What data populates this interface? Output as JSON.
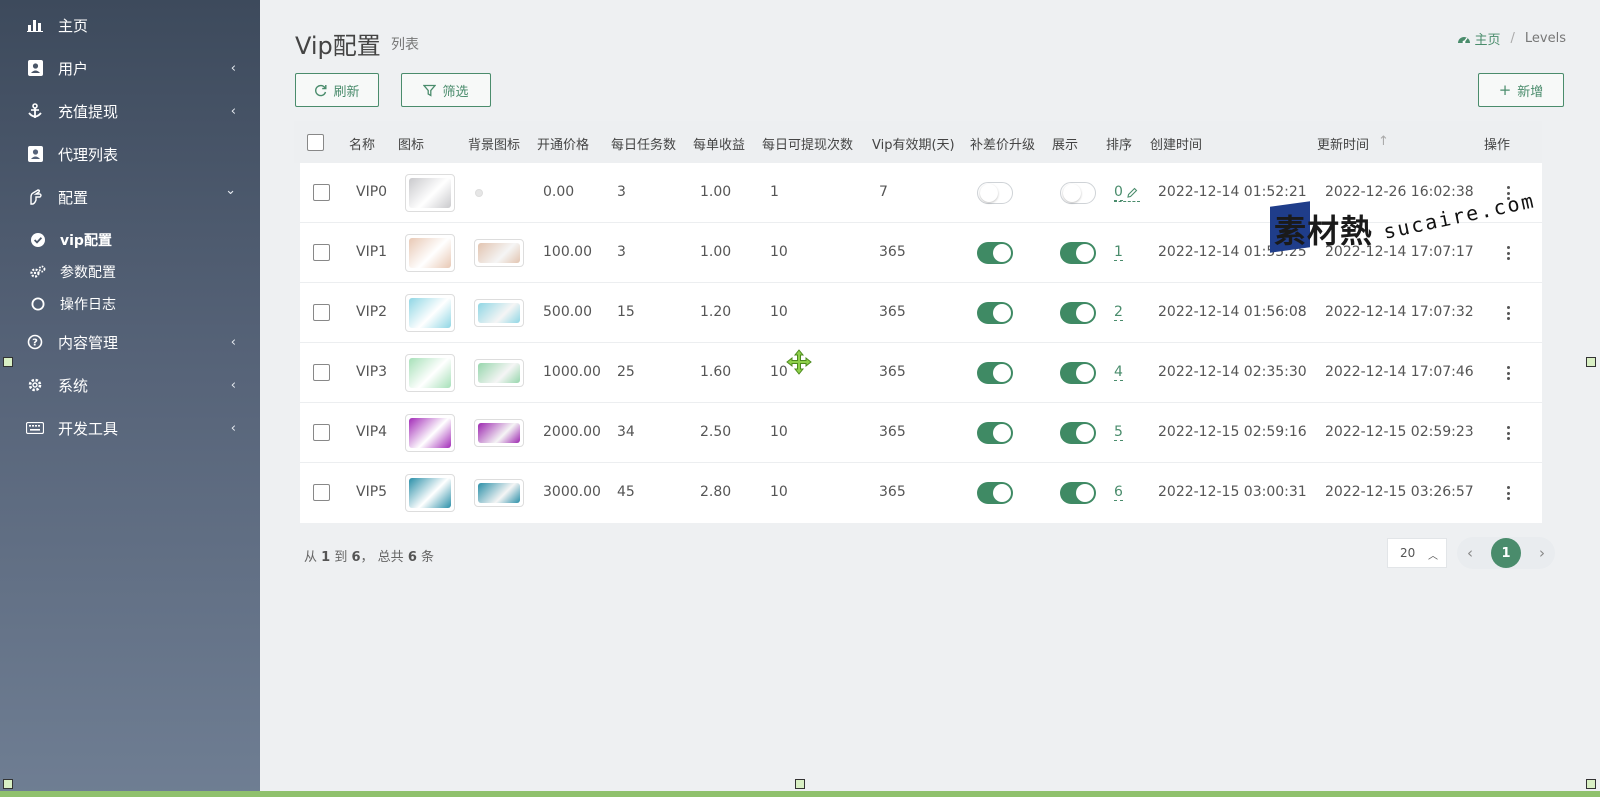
{
  "sidebar": {
    "items": [
      {
        "label": "主页",
        "icon": "bar-chart-icon",
        "chevron": ""
      },
      {
        "label": "用户",
        "icon": "id-card-icon",
        "chevron": "‹"
      },
      {
        "label": "充值提现",
        "icon": "anchor-icon",
        "chevron": "‹"
      },
      {
        "label": "代理列表",
        "icon": "address-book-icon",
        "chevron": ""
      },
      {
        "label": "配置",
        "icon": "hand-icon",
        "chevron": "⌄"
      },
      {
        "label": "内容管理",
        "icon": "question-circle-icon",
        "chevron": "‹"
      },
      {
        "label": "系统",
        "icon": "gear-icon",
        "chevron": "‹"
      },
      {
        "label": "开发工具",
        "icon": "keyboard-icon",
        "chevron": "‹"
      }
    ],
    "subitems": [
      {
        "label": "vip配置",
        "icon": "check-circle-icon",
        "active": true
      },
      {
        "label": "参数配置",
        "icon": "cogs-icon",
        "active": false
      },
      {
        "label": "操作日志",
        "icon": "circle-outline-icon",
        "active": false
      }
    ]
  },
  "header": {
    "title": "Vip配置",
    "subtitle": "列表",
    "breadcrumb": {
      "home": "主页",
      "separator": "/",
      "current": "Levels"
    }
  },
  "toolbar": {
    "refresh_label": "刷新",
    "filter_label": "筛选",
    "add_label": "新增"
  },
  "table": {
    "columns": [
      "名称",
      "图标",
      "背景图标",
      "开通价格",
      "每日任务数",
      "每单收益",
      "每日可提现次数",
      "Vip有效期(天)",
      "补差价升级",
      "展示",
      "排序",
      "创建时间",
      "更新时间",
      "操作"
    ],
    "sort_indicator": "↑",
    "rows": [
      {
        "name": "VIP0",
        "icon_color": "#c9c9cc",
        "bg_color": "",
        "price": "0.00",
        "tasks": "3",
        "profit": "1.00",
        "withdraw": "1",
        "days": "7",
        "upgrade": false,
        "show": false,
        "sort": "0",
        "created": "2022-12-14 01:52:21",
        "updated": "2022-12-26 16:02:38"
      },
      {
        "name": "VIP1",
        "icon_color": "#e8c8b4",
        "bg_color": "#e2c4b0",
        "price": "100.00",
        "tasks": "3",
        "profit": "1.00",
        "withdraw": "10",
        "days": "365",
        "upgrade": true,
        "show": true,
        "sort": "1",
        "created": "2022-12-14 01:55:25",
        "updated": "2022-12-14 17:07:17"
      },
      {
        "name": "VIP2",
        "icon_color": "#8fd6e4",
        "bg_color": "#8fd6e4",
        "price": "500.00",
        "tasks": "15",
        "profit": "1.20",
        "withdraw": "10",
        "days": "365",
        "upgrade": true,
        "show": true,
        "sort": "2",
        "created": "2022-12-14 01:56:08",
        "updated": "2022-12-14 17:07:32"
      },
      {
        "name": "VIP3",
        "icon_color": "#a6e0b8",
        "bg_color": "#96d6ac",
        "price": "1000.00",
        "tasks": "25",
        "profit": "1.60",
        "withdraw": "10",
        "days": "365",
        "upgrade": true,
        "show": true,
        "sort": "4",
        "created": "2022-12-14 02:35:30",
        "updated": "2022-12-14 17:07:46"
      },
      {
        "name": "VIP4",
        "icon_color": "#a22bb8",
        "bg_color": "#9c27b0",
        "price": "2000.00",
        "tasks": "34",
        "profit": "2.50",
        "withdraw": "10",
        "days": "365",
        "upgrade": true,
        "show": true,
        "sort": "5",
        "created": "2022-12-15 02:59:16",
        "updated": "2022-12-15 02:59:23"
      },
      {
        "name": "VIP5",
        "icon_color": "#2a8fa8",
        "bg_color": "#2a8fa8",
        "price": "3000.00",
        "tasks": "45",
        "profit": "2.80",
        "withdraw": "10",
        "days": "365",
        "upgrade": true,
        "show": true,
        "sort": "6",
        "created": "2022-12-15 03:00:31",
        "updated": "2022-12-15 03:26:57"
      }
    ]
  },
  "footer": {
    "summary_from": "从",
    "summary_start": "1",
    "summary_to": "到",
    "summary_end": "6",
    "summary_total_label": "， 总共",
    "summary_total": "6",
    "summary_unit": "条",
    "page_size": "20",
    "current_page": "1"
  },
  "watermark": {
    "cn": "素材熱",
    "en": "sucaire.com"
  },
  "colors": {
    "accent": "#4a8c6c",
    "toggle_on": "#3f8a64"
  }
}
